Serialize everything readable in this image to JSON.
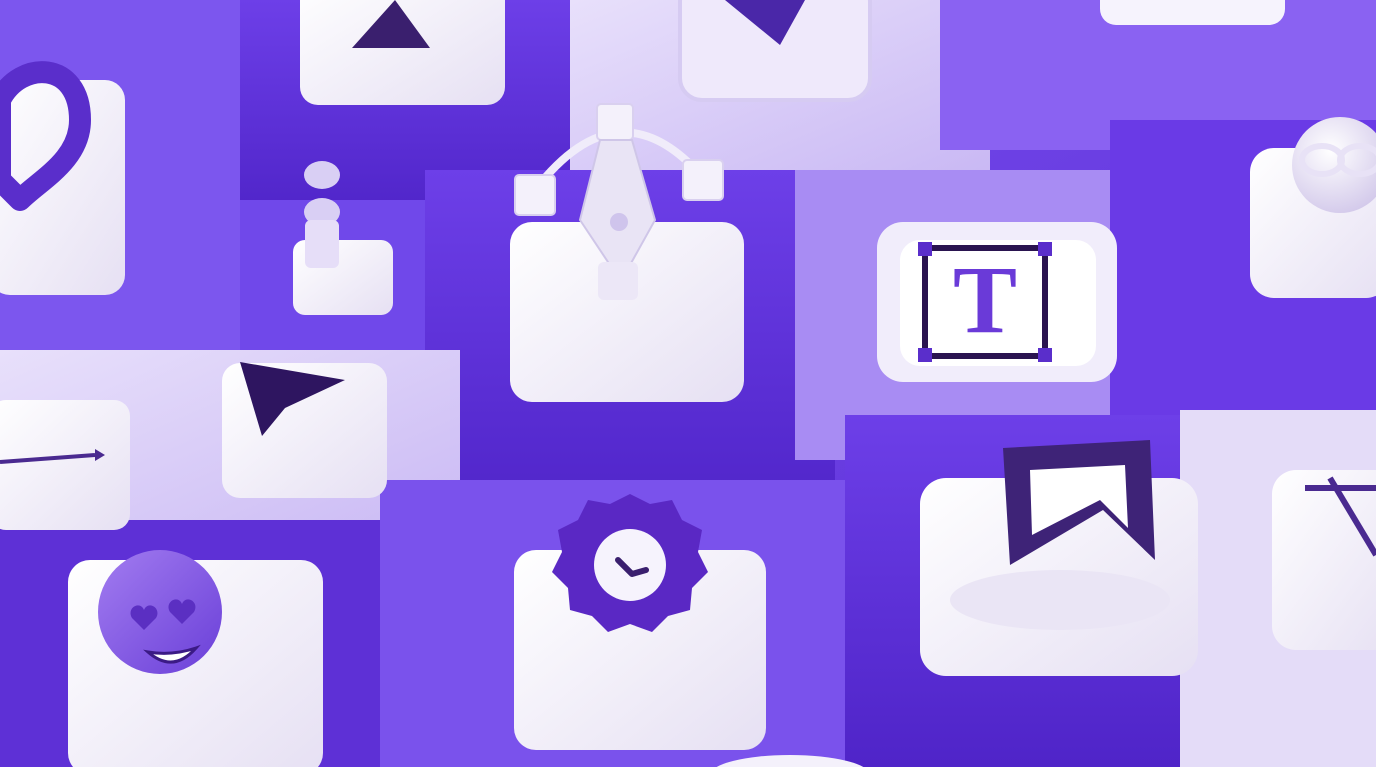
{
  "palette": {
    "deep_purple": "#5a2ed4",
    "mid_purple": "#7a4cf0",
    "light_lavender": "#d9cdf8",
    "pale_lavender": "#ebe4fb",
    "white_tile": "#f4f1fb",
    "dark_icon": "#3a1f6e",
    "emoji_purple": "#8a5ae6"
  },
  "tiles": {
    "type_tool": {
      "letter": "T",
      "icon": "text-frame-icon"
    },
    "pen_tool": {
      "icon": "pen-tool-icon"
    },
    "cursor": {
      "icon": "cursor-arrow-icon"
    },
    "arrow_line": {
      "icon": "arrow-line-icon"
    },
    "heart": {
      "icon": "heart-icon"
    },
    "emoji": {
      "icon": "heart-eyes-emoji-icon"
    },
    "badge": {
      "icon": "check-badge-icon"
    },
    "bookmark": {
      "icon": "bookmark-icon"
    },
    "align": {
      "icon": "align-nodes-icon"
    },
    "sphere": {
      "icon": "glasses-sphere-icon"
    },
    "crop": {
      "icon": "crop-icon"
    }
  }
}
